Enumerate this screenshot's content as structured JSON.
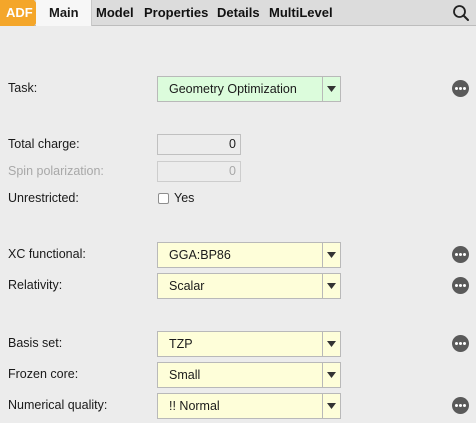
{
  "tabs": {
    "adf": "ADF",
    "main": "Main",
    "items": [
      "Model",
      "Properties",
      "Details",
      "MultiLevel"
    ]
  },
  "form": {
    "task": {
      "label": "Task:",
      "value": "Geometry Optimization"
    },
    "total_charge": {
      "label": "Total charge:",
      "value": "0"
    },
    "spin_polarization": {
      "label": "Spin polarization:",
      "value": "0"
    },
    "unrestricted": {
      "label": "Unrestricted:",
      "option": "Yes",
      "checked": false
    },
    "xc_functional": {
      "label": "XC functional:",
      "value": "GGA:BP86"
    },
    "relativity": {
      "label": "Relativity:",
      "value": "Scalar"
    },
    "basis_set": {
      "label": "Basis set:",
      "value": "TZP"
    },
    "frozen_core": {
      "label": "Frozen core:",
      "value": "Small"
    },
    "numerical_quality": {
      "label": "Numerical quality:",
      "value": "!! Normal"
    }
  },
  "colors": {
    "adf_tab": "#f4a62a",
    "select_bg": "#fefed9",
    "task_bg": "#dcfcdc",
    "more_button": "#5a5a5a"
  },
  "icons": {
    "search": "search-icon",
    "more": "more-options-icon",
    "dropdown": "chevron-down-icon"
  }
}
